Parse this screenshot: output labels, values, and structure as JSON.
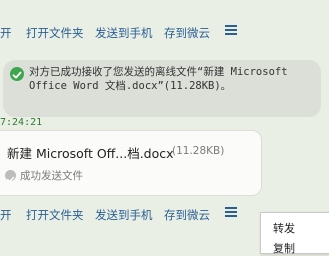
{
  "top_actions": {
    "open_label": "开",
    "open_folder_label": "打开文件夹",
    "send_to_phone_label": "发送到手机",
    "save_to_weiyun_label": "存到微云",
    "menu_icon": "menu-icon"
  },
  "notice": {
    "text": "对方已成功接收了您发送的离线文件“新建 Microsoft Office Word 文档.docx”(11.28KB)。",
    "icon": "check-circle-icon"
  },
  "timestamp": "7:24:21",
  "file_message": {
    "file_name": "新建 Microsoft Off...档.docx",
    "file_size": "(11.28KB)",
    "status_text": "成功发送文件",
    "status_icon": "check-circle-icon"
  },
  "bottom_actions": {
    "open_label": "开",
    "open_folder_label": "打开文件夹",
    "send_to_phone_label": "发送到手机",
    "save_to_weiyun_label": "存到微云",
    "menu_icon": "menu-icon"
  },
  "context_menu": {
    "items": [
      "转发",
      "复制"
    ]
  },
  "colors": {
    "link": "#2b5f93",
    "success_green": "#3fa650",
    "timestamp_green": "#2d7a2d",
    "background": "#e9efe5"
  }
}
